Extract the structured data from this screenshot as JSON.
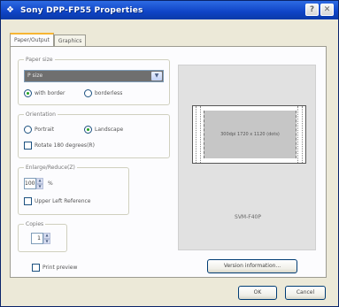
{
  "window": {
    "title": "Sony DPP-FP55 Properties",
    "help_glyph": "?",
    "close_glyph": "✕"
  },
  "tabs": [
    {
      "label": "Paper/Output",
      "active": true
    },
    {
      "label": "Graphics",
      "active": false
    }
  ],
  "paper_size": {
    "legend": "Paper size",
    "value": "P size",
    "radio_with_border": "with border",
    "radio_borderless": "borderless",
    "selected": "with border"
  },
  "orientation": {
    "legend": "Orientation",
    "portrait": "Portrait",
    "landscape": "Landscape",
    "selected": "Landscape",
    "rotate_label": "Rotate 180 degrees(R)"
  },
  "enlarge": {
    "legend": "Enlarge/Reduce(Z)",
    "value": "100",
    "unit": "%",
    "upper_left_label": "Upper Left Reference"
  },
  "copies": {
    "legend": "Copies",
    "value": "1"
  },
  "print_preview": {
    "label": "Print preview"
  },
  "preview": {
    "printable_area": "300dpi 1720 x 1120 (dots)",
    "printer_name": "SVM-F40P"
  },
  "buttons": {
    "version": "Version information...",
    "ok": "OK",
    "cancel": "Cancel"
  },
  "colors": {
    "titlebar": "#0f44c6",
    "dialog_bg": "#ece9d8",
    "panel_bg": "#fcfcfe",
    "tab_accent": "#f7b533"
  }
}
